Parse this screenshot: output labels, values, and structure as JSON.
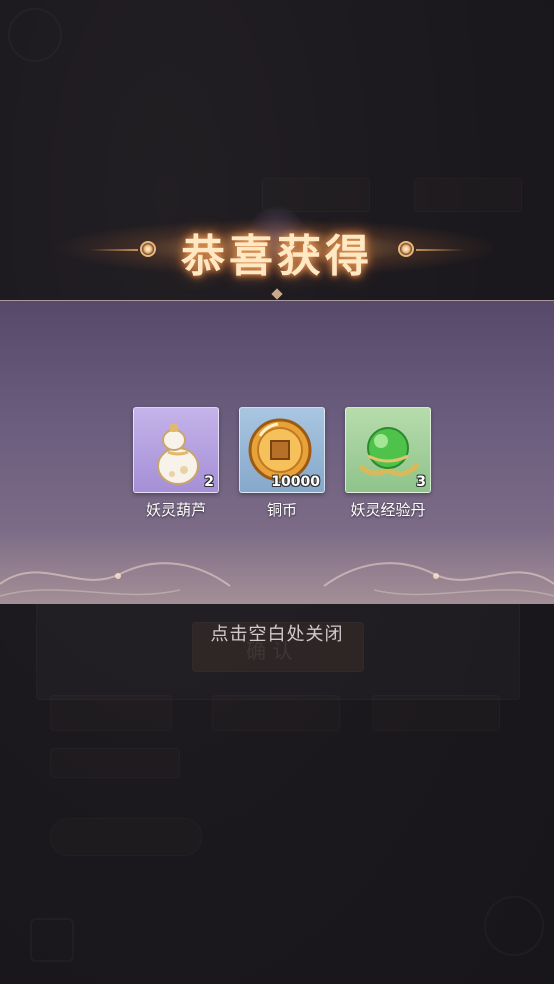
{
  "banner": {
    "title": "恭喜获得"
  },
  "rewards": [
    {
      "name": "妖灵葫芦",
      "count": "2",
      "icon": "gourd-icon",
      "tile_color": "#b59fe0"
    },
    {
      "name": "铜币",
      "count": "10000",
      "icon": "copper-coin-icon",
      "tile_color": "#98b7d6"
    },
    {
      "name": "妖灵经验丹",
      "count": "3",
      "icon": "green-pill-icon",
      "tile_color": "#a3d09c"
    }
  ],
  "hint": "点击空白处关闭",
  "background_ui": {
    "confirm_label": "确 认"
  },
  "colors": {
    "panel": "#6b5d7e",
    "banner_glow": "#f3a35f",
    "title": "#ffe8c4"
  }
}
